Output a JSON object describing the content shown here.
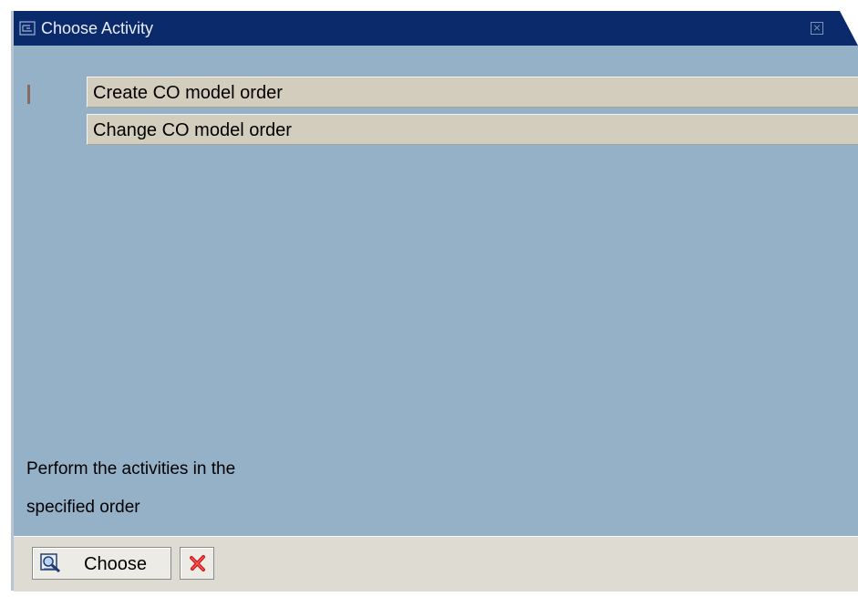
{
  "window": {
    "title": "Choose Activity",
    "icons": {
      "system": "window-menu-icon",
      "close": "close-icon"
    }
  },
  "activities": [
    {
      "label": "Create CO model order"
    },
    {
      "label": "Change CO model order"
    }
  ],
  "help_text": {
    "line1": "Perform the activities in the",
    "line2": "specified order"
  },
  "buttons": {
    "choose": {
      "label": "Choose",
      "icon": "choose-check-icon"
    },
    "cancel": {
      "icon": "cancel-x-icon"
    }
  },
  "colors": {
    "titlebar": "#0b2a6b",
    "content": "#94b1c8",
    "item": "#d3cdbe",
    "footer": "#dedbd2",
    "cancel": "#d01818"
  }
}
